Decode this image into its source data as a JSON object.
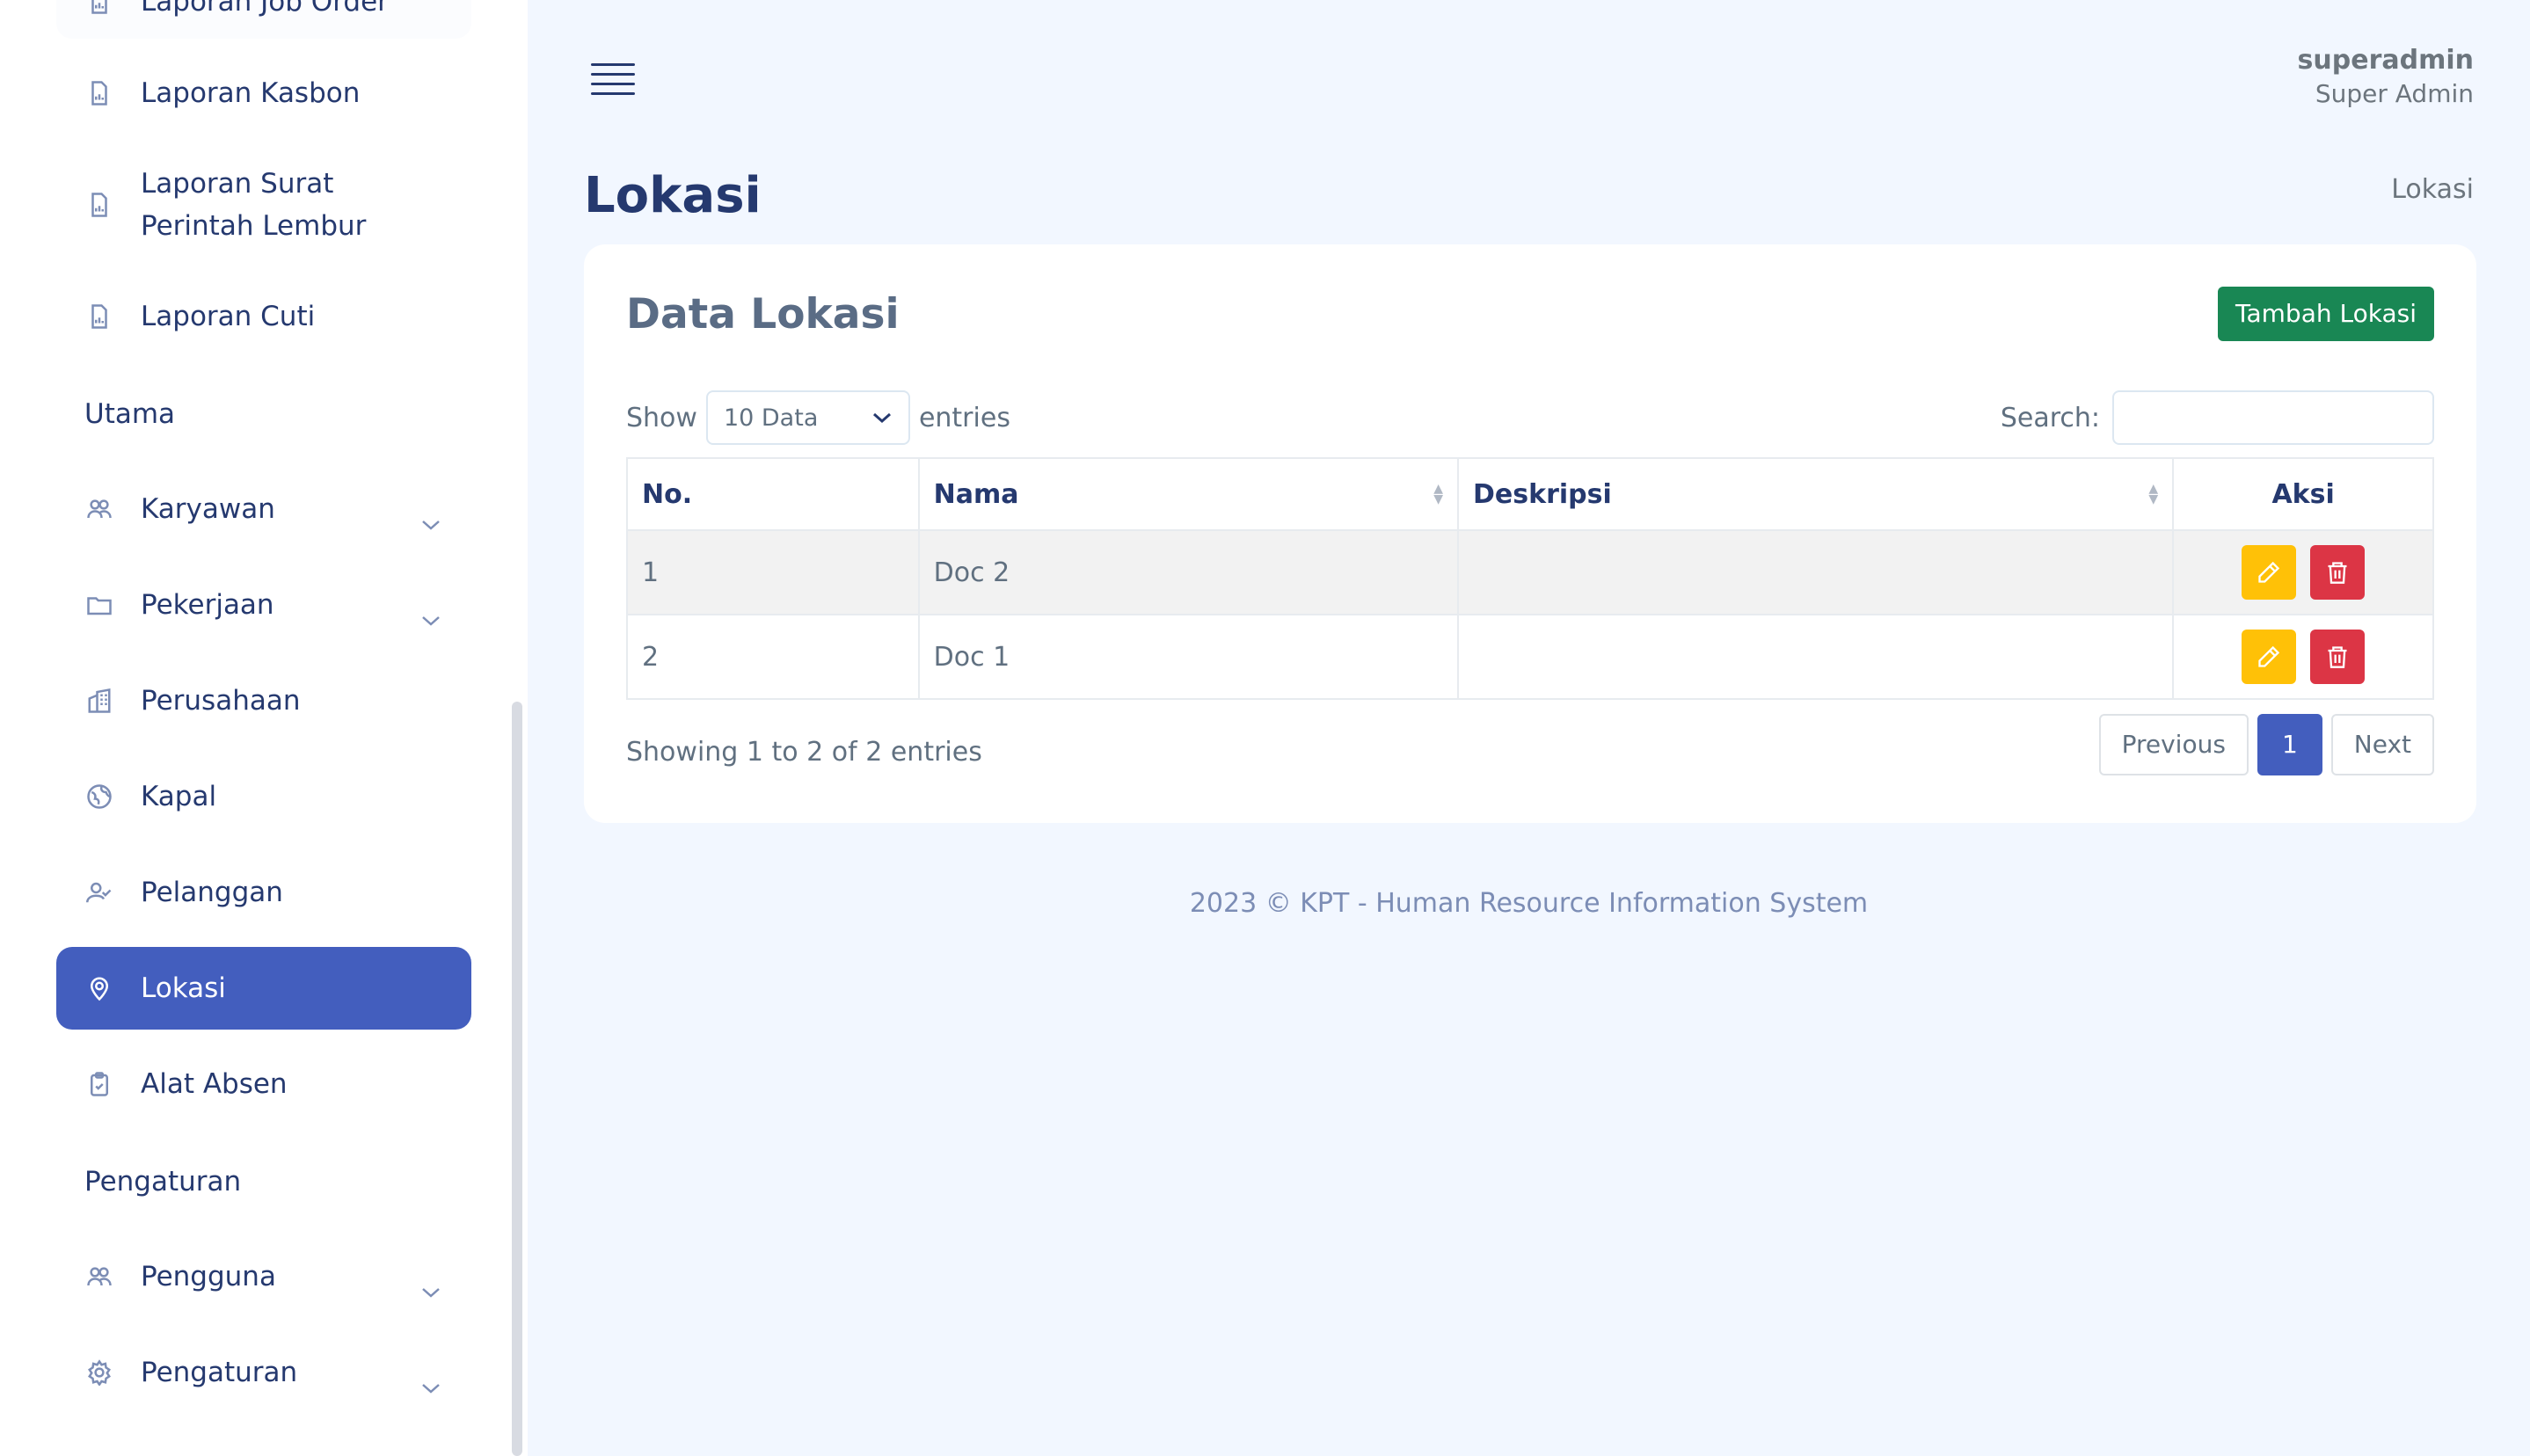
{
  "sidebar": {
    "items": [
      {
        "label": "Laporan Job Order",
        "icon": "report-icon"
      },
      {
        "label": "Laporan Kasbon",
        "icon": "report-icon"
      },
      {
        "label": "Laporan Surat Perintah Lembur",
        "icon": "report-icon"
      },
      {
        "label": "Laporan Cuti",
        "icon": "report-icon"
      }
    ],
    "section_utama": "Utama",
    "utama_items": [
      {
        "label": "Karyawan",
        "icon": "people-icon",
        "has_submenu": true
      },
      {
        "label": "Pekerjaan",
        "icon": "folder-icon",
        "has_submenu": true
      },
      {
        "label": "Perusahaan",
        "icon": "building-icon",
        "has_submenu": false
      },
      {
        "label": "Kapal",
        "icon": "globe-icon",
        "has_submenu": false
      },
      {
        "label": "Pelanggan",
        "icon": "person-check-icon",
        "has_submenu": false
      },
      {
        "label": "Lokasi",
        "icon": "geo-pin-icon",
        "has_submenu": false,
        "active": true
      },
      {
        "label": "Alat Absen",
        "icon": "clipboard-check-icon",
        "has_submenu": false
      }
    ],
    "section_pengaturan": "Pengaturan",
    "pengaturan_items": [
      {
        "label": "Pengguna",
        "icon": "people-icon",
        "has_submenu": true
      },
      {
        "label": "Pengaturan",
        "icon": "gear-icon",
        "has_submenu": true
      }
    ]
  },
  "header": {
    "user_name": "superadmin",
    "user_role": "Super Admin"
  },
  "page": {
    "title": "Lokasi",
    "breadcrumb": "Lokasi"
  },
  "card": {
    "title": "Data Lokasi",
    "add_button": "Tambah Lokasi",
    "show_label": "Show",
    "length_value": "10 Data",
    "entries_label": "entries",
    "search_label": "Search:",
    "search_value": ""
  },
  "table": {
    "columns": [
      "No.",
      "Nama",
      "Deskripsi",
      "Aksi"
    ],
    "rows": [
      {
        "no": "1",
        "nama": "Doc 2",
        "deskripsi": ""
      },
      {
        "no": "2",
        "nama": "Doc 1",
        "deskripsi": ""
      }
    ]
  },
  "pagination": {
    "info": "Showing 1 to 2 of 2 entries",
    "previous": "Previous",
    "current": "1",
    "next": "Next"
  },
  "footer": {
    "text": "2023 © KPT - Human Resource Information System"
  },
  "colors": {
    "primary": "#435ebe",
    "success": "#198754",
    "warning": "#ffc107",
    "danger": "#dc3545",
    "background": "#f2f7ff"
  }
}
